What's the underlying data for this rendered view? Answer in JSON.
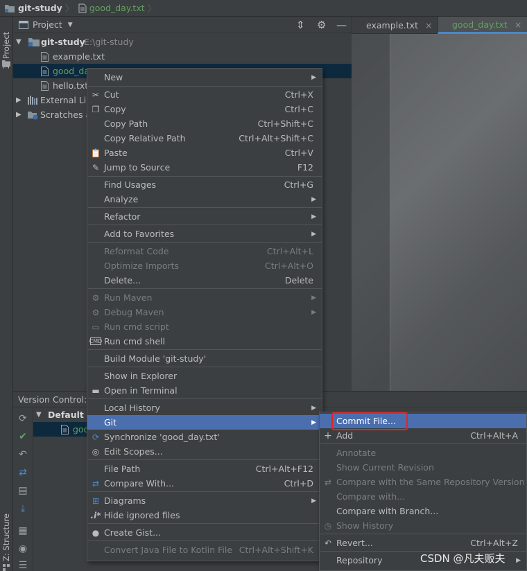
{
  "breadcrumb": {
    "project": "git-study",
    "file": "good_day.txt"
  },
  "sidebar": {
    "project_tab": "1: Project",
    "structure_tab": "Z: Structure"
  },
  "project_panel": {
    "title": "Project",
    "tree": {
      "root": {
        "name": "git-study",
        "path": "E:\\git-study"
      },
      "files": [
        "example.txt",
        "good_da",
        "hello.txt"
      ],
      "external": "External Lib",
      "scratches": "Scratches a"
    }
  },
  "editor": {
    "tabs": [
      {
        "label": "example.txt"
      },
      {
        "label": "good_day.txt"
      }
    ]
  },
  "version_control": {
    "title": "Version Control:",
    "changelist": "Default C",
    "file": "good"
  },
  "context_menu": {
    "items": [
      {
        "label": "New"
      },
      {
        "label": "Cut",
        "shortcut": "Ctrl+X"
      },
      {
        "label": "Copy",
        "shortcut": "Ctrl+C"
      },
      {
        "label": "Copy Path",
        "shortcut": "Ctrl+Shift+C"
      },
      {
        "label": "Copy Relative Path",
        "shortcut": "Ctrl+Alt+Shift+C"
      },
      {
        "label": "Paste",
        "shortcut": "Ctrl+V"
      },
      {
        "label": "Jump to Source",
        "shortcut": "F12"
      },
      {
        "label": "Find Usages",
        "shortcut": "Ctrl+G"
      },
      {
        "label": "Analyze"
      },
      {
        "label": "Refactor"
      },
      {
        "label": "Add to Favorites"
      },
      {
        "label": "Reformat Code",
        "shortcut": "Ctrl+Alt+L"
      },
      {
        "label": "Optimize Imports",
        "shortcut": "Ctrl+Alt+O"
      },
      {
        "label": "Delete...",
        "shortcut": "Delete"
      },
      {
        "label": "Run Maven"
      },
      {
        "label": "Debug Maven"
      },
      {
        "label": "Run cmd script"
      },
      {
        "label": "Run cmd shell"
      },
      {
        "label": "Build Module 'git-study'"
      },
      {
        "label": "Show in Explorer"
      },
      {
        "label": "Open in Terminal"
      },
      {
        "label": "Local History"
      },
      {
        "label": "Git"
      },
      {
        "label": "Synchronize 'good_day.txt'"
      },
      {
        "label": "Edit Scopes..."
      },
      {
        "label": "File Path",
        "shortcut": "Ctrl+Alt+F12"
      },
      {
        "label": "Compare With...",
        "shortcut": "Ctrl+D"
      },
      {
        "label": "Diagrams"
      },
      {
        "label": "Hide ignored files"
      },
      {
        "label": "Create Gist..."
      },
      {
        "label": "Convert Java File to Kotlin File",
        "shortcut": "Ctrl+Alt+Shift+K"
      }
    ]
  },
  "git_submenu": {
    "items": [
      {
        "label": "Commit File..."
      },
      {
        "label": "Add",
        "shortcut": "Ctrl+Alt+A"
      },
      {
        "label": "Annotate"
      },
      {
        "label": "Show Current Revision"
      },
      {
        "label": "Compare with the Same Repository Version"
      },
      {
        "label": "Compare with..."
      },
      {
        "label": "Compare with Branch..."
      },
      {
        "label": "Show History"
      },
      {
        "label": "Revert...",
        "shortcut": "Ctrl+Alt+Z"
      },
      {
        "label": "Repository"
      }
    ]
  },
  "watermark": "CSDN @凡夫贩夫",
  "colors": {
    "highlight": "#4b6eaf",
    "annotation_box": "#e8231f",
    "vcs_added_green": "#62a15e"
  }
}
